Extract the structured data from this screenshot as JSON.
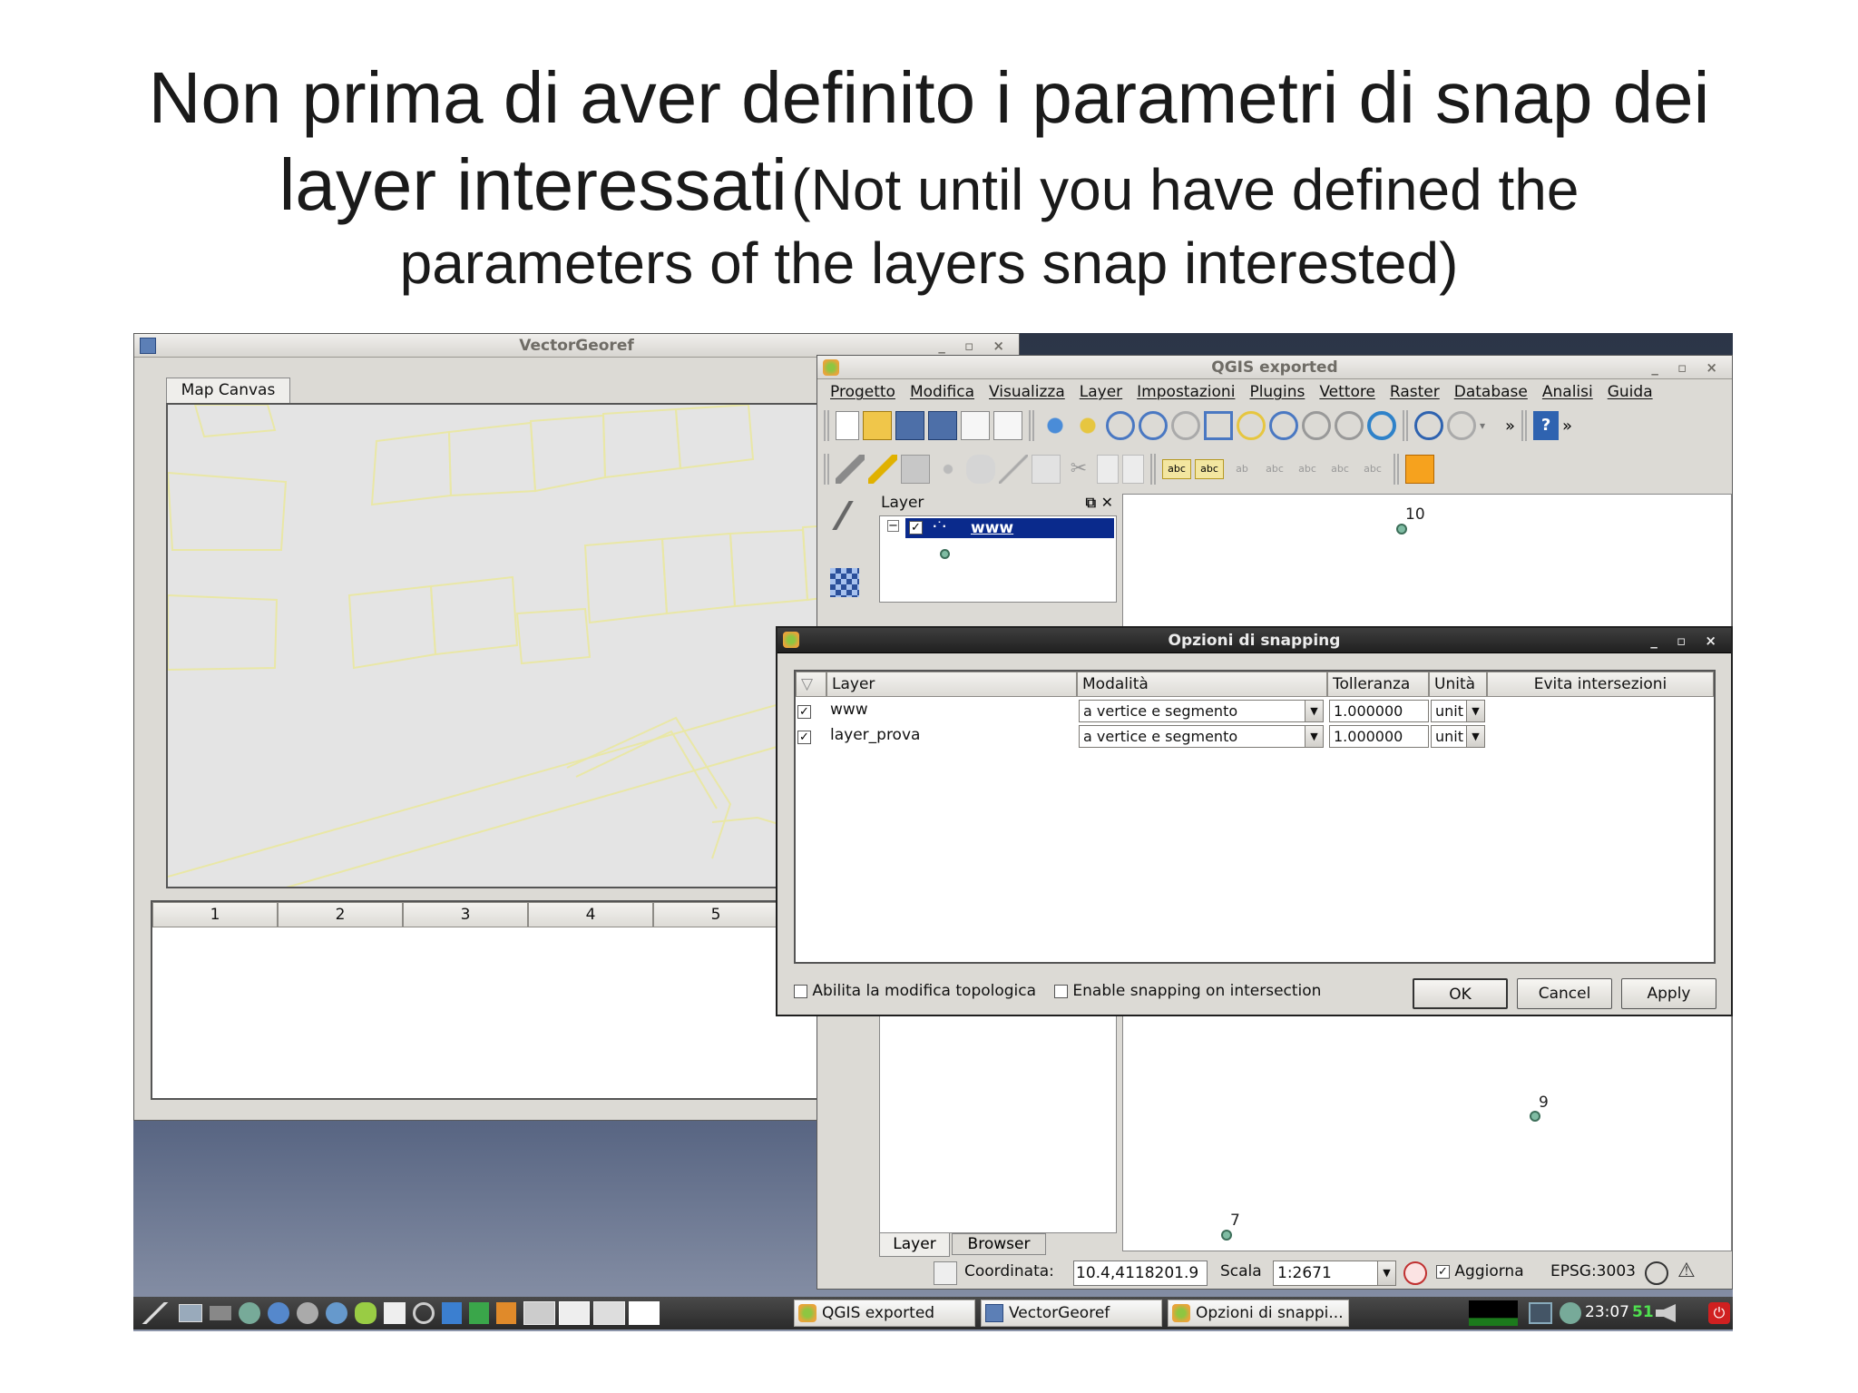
{
  "slide": {
    "title_line1": "Non prima di aver definito i parametri di snap dei",
    "title_line2_main": "layer interessati",
    "title_line2_sub": "(Not until you have defined the",
    "title_line3": "parameters of the layers snap interested)"
  },
  "vector_georef": {
    "title": "VectorGeoref",
    "controls": "_ ▫ ×",
    "tab_label": "Map Canvas",
    "table_columns": [
      "1",
      "2",
      "3",
      "4",
      "5"
    ]
  },
  "qgis": {
    "title": "QGIS exported",
    "controls": "_ ▫ ×",
    "menu": [
      "Progetto",
      "Modifica",
      "Visualizza",
      "Layer",
      "Impostazioni",
      "Plugins",
      "Vettore",
      "Raster",
      "Database",
      "Analisi",
      "Guida"
    ],
    "layer_panel_title": "Layer",
    "layer_name": "www",
    "panel_tabs": [
      "Layer",
      "Browser"
    ],
    "status": {
      "coord_label": "Coordinata:",
      "coord_value": "10.4,4118201.9",
      "scale_label": "Scala",
      "scale_value": "1:2671",
      "refresh_label": "Aggiorna",
      "crs": "EPSG:3003"
    },
    "map_points": [
      "10",
      "9",
      "7"
    ]
  },
  "snapping_dialog": {
    "title": "Opzioni di snapping",
    "controls": "_ ▫ ×",
    "columns": [
      "Layer",
      "Modalità",
      "Tolleranza",
      "Unità",
      "Evita intersezioni"
    ],
    "rows": [
      {
        "layer": "www",
        "mode": "a vertice e segmento",
        "tolerance": "1.000000",
        "unit": "unit"
      },
      {
        "layer": "layer_prova",
        "mode": "a vertice e segmento",
        "tolerance": "1.000000",
        "unit": "unit"
      }
    ],
    "topological_editing": "Abilita la modifica topologica",
    "snap_on_intersection": "Enable snapping on intersection",
    "ok_label": "OK",
    "cancel_label": "Cancel",
    "apply_label": "Apply"
  },
  "taskbar": {
    "tasks": [
      "QGIS exported",
      "VectorGeoref",
      "Opzioni di snappi..."
    ],
    "clock": "23:07",
    "cpu": "51"
  },
  "colors": {
    "selection": "#0a2a8c",
    "dark_title": "#262626",
    "point_fill": "#7fbca3"
  }
}
